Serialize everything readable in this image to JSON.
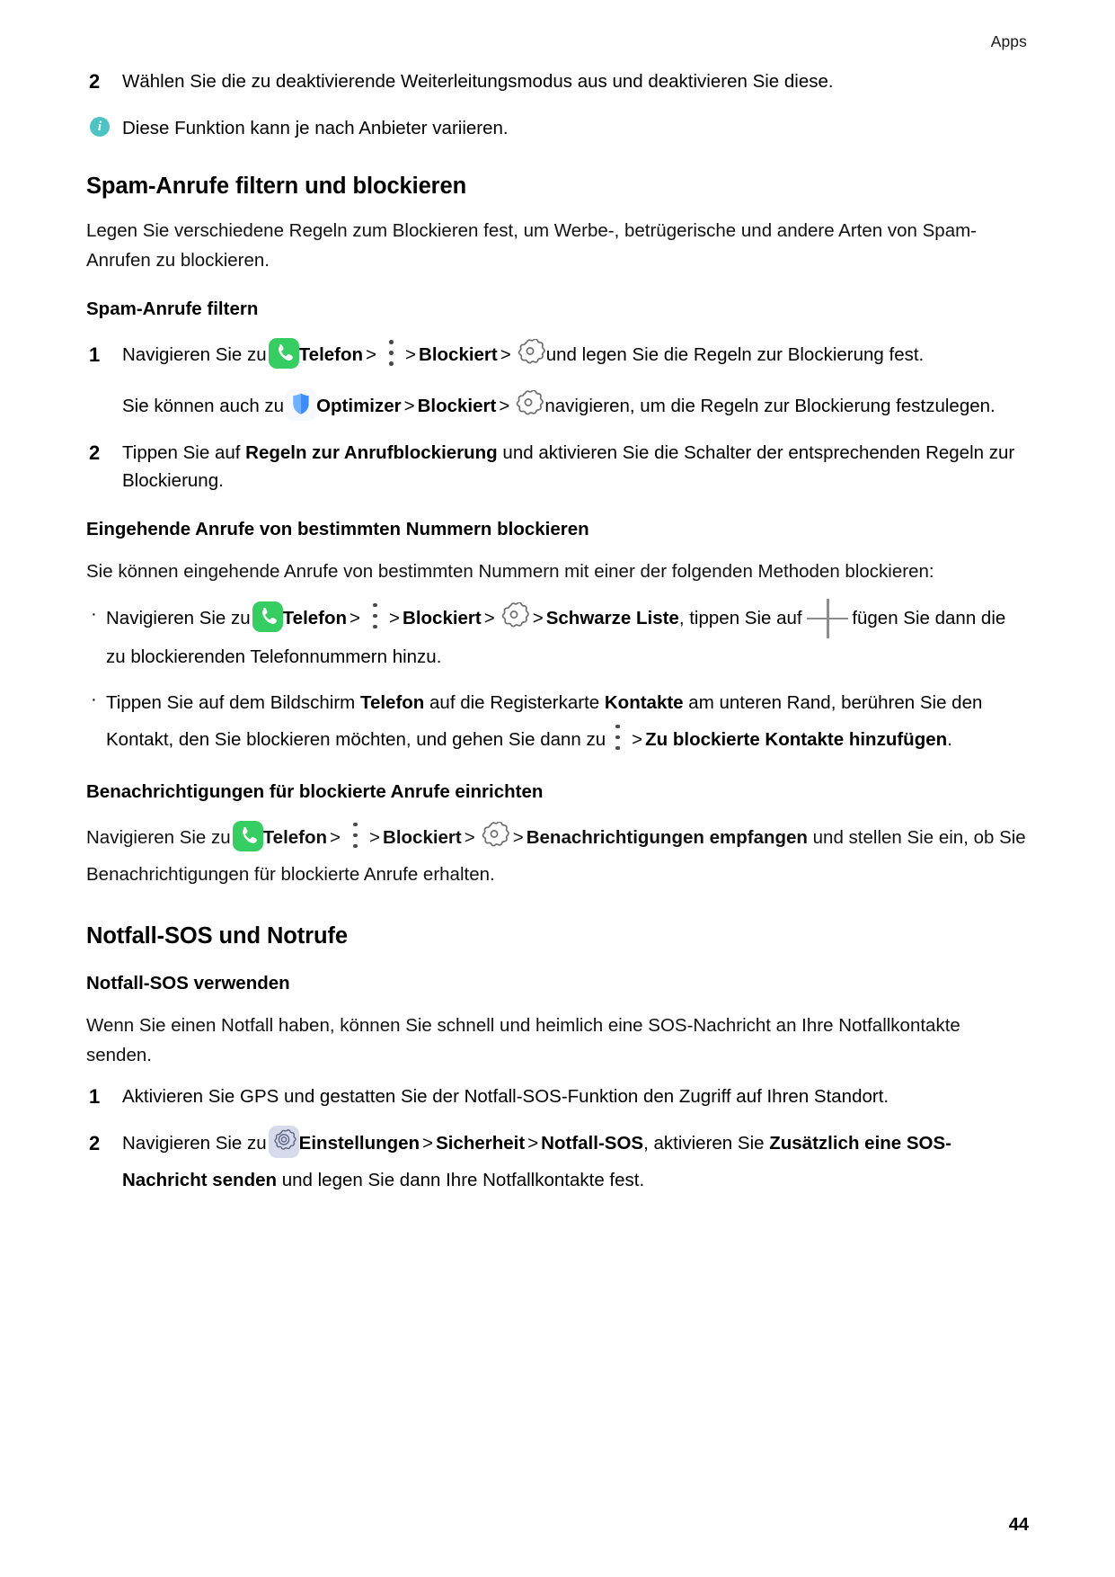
{
  "header": {
    "running_head": "Apps"
  },
  "page_number": "44",
  "icons": {
    "phone": "phone-app-icon",
    "optimizer": "optimizer-shield-icon",
    "settings": "settings-gear-app-icon",
    "kebab": "more-options-icon",
    "gear": "settings-gear-icon",
    "plus": "add-plus-icon",
    "info": "info-icon"
  },
  "colors": {
    "phone_green": "#36ce62",
    "info_teal": "#4ec3c3",
    "optimizer_blue": "#3d8bff",
    "settings_lavender": "#d7daea",
    "gear_gray": "#6e6e6e"
  },
  "content": {
    "step2_forwarding": {
      "num": "2",
      "text": "Wählen Sie die zu deaktivierende Weiterleitungsmodus aus und deaktivieren Sie diese."
    },
    "note_provider": "Diese Funktion kann je nach Anbieter variieren.",
    "h2_spam": "Spam-Anrufe filtern und blockieren",
    "intro_spam": "Legen Sie verschiedene Regeln zum Blockieren fest, um Werbe-, betrügerische und andere Arten von Spam-Anrufen zu blockieren.",
    "h3_filter": "Spam-Anrufe filtern",
    "filter_step1": {
      "num": "1",
      "lead": "Navigieren Sie zu",
      "app": "Telefon",
      "blocked": "Blockiert",
      "tail": "und legen Sie die Regeln zur Blockierung fest."
    },
    "filter_substep": {
      "lead": "Sie können auch zu",
      "app": "Optimizer",
      "blocked": "Blockiert",
      "tail": "navigieren, um die Regeln zur Blockierung festzulegen."
    },
    "filter_step2": {
      "num": "2",
      "pre": "Tippen Sie auf ",
      "bold": "Regeln zur Anrufblockierung",
      "post": " und aktivieren Sie die Schalter der entsprechenden Regeln zur Blockierung."
    },
    "h3_incoming": "Eingehende Anrufe von bestimmten Nummern blockieren",
    "intro_incoming": "Sie können eingehende Anrufe von bestimmten Nummern mit einer der folgenden Methoden blockieren:",
    "bullet1": {
      "lead": "Navigieren Sie zu",
      "app": "Telefon",
      "blocked": "Blockiert",
      "blacklist": "Schwarze Liste",
      "mid": ", tippen Sie auf",
      "tail": "fügen Sie dann die zu blockierenden Telefonnummern hinzu."
    },
    "bullet2": {
      "p1": "Tippen Sie auf dem Bildschirm ",
      "b1": "Telefon",
      "p2": " auf die Registerkarte ",
      "b2": "Kontakte",
      "p3": " am unteren Rand, berühren Sie den Kontakt, den Sie blockieren möchten, und gehen Sie dann zu",
      "b3": "Zu blockierte Kontakte hinzufügen",
      "p4": "."
    },
    "h3_notify": "Benachrichtigungen für blockierte Anrufe einrichten",
    "notify_para": {
      "lead": "Navigieren Sie zu",
      "app": "Telefon",
      "blocked": "Blockiert",
      "receive": "Benachrichtigungen empfangen",
      "tail": "und stellen Sie ein, ob Sie Benachrichtigungen für blockierte Anrufe erhalten."
    },
    "h2_sos": "Notfall-SOS und Notrufe",
    "h3_sos_use": "Notfall-SOS verwenden",
    "intro_sos": "Wenn Sie einen Notfall haben, können Sie schnell und heimlich eine SOS-Nachricht an Ihre Notfallkontakte senden.",
    "sos_step1": {
      "num": "1",
      "text": "Aktivieren Sie GPS und gestatten Sie der Notfall-SOS-Funktion den Zugriff auf Ihren Standort."
    },
    "sos_step2": {
      "num": "2",
      "lead": "Navigieren Sie zu",
      "app": "Einstellungen",
      "security": "Sicherheit",
      "sos": "Notfall-SOS",
      "mid": ", aktivieren Sie ",
      "bold": "Zusätzlich eine SOS-Nachricht senden",
      "tail": " und legen Sie dann Ihre Notfallkontakte fest."
    }
  }
}
